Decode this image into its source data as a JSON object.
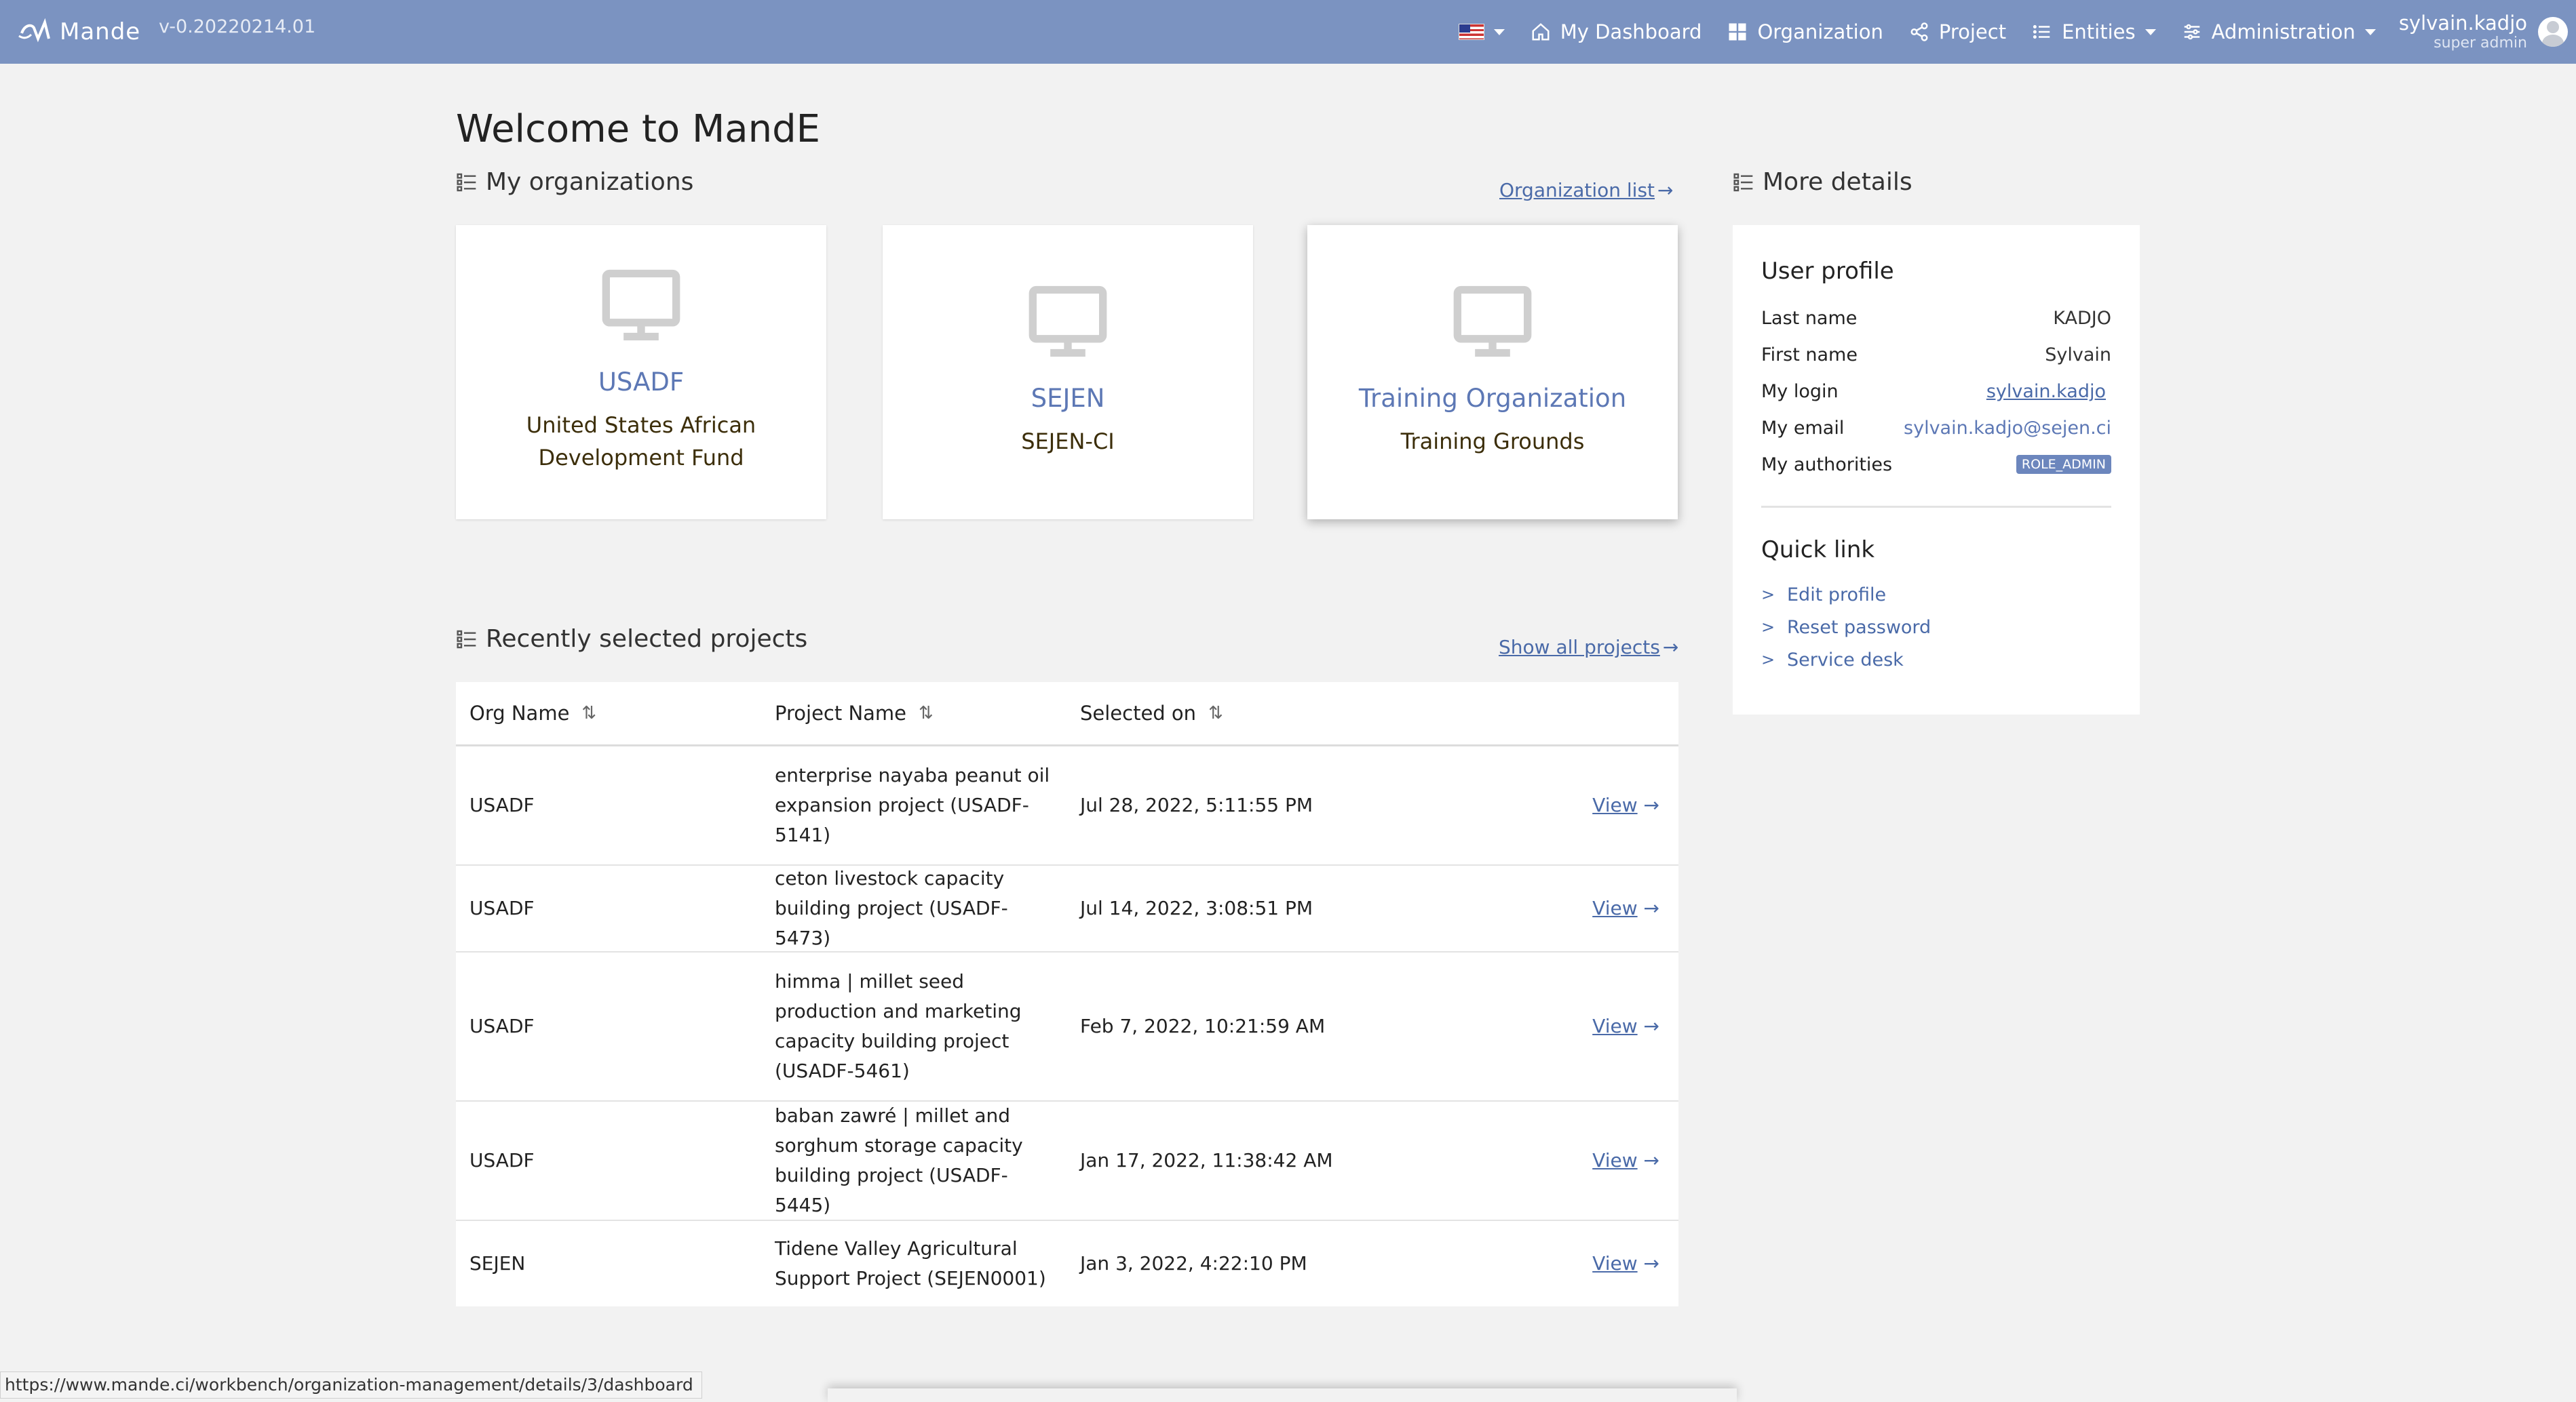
{
  "navbar": {
    "logo_text": "Mande",
    "version": "v-0.20220214.01",
    "items": [
      {
        "label": "My Dashboard",
        "icon": "home-icon"
      },
      {
        "label": "Organization",
        "icon": "grid-icon"
      },
      {
        "label": "Project",
        "icon": "share-icon"
      },
      {
        "label": "Entities",
        "icon": "list-icon"
      },
      {
        "label": "Administration",
        "icon": "sliders-icon"
      }
    ],
    "user": {
      "name": "sylvain.kadjo",
      "role": "super admin"
    },
    "colors": {
      "navbar": "#7b93c1",
      "accent": "#4a6aa8"
    }
  },
  "page": {
    "title": "Welcome to MandE"
  },
  "organizations": {
    "title": "My organizations",
    "list_link": "Organization list",
    "cards": [
      {
        "code": "USADF",
        "name": "United States African Development Fund"
      },
      {
        "code": "SEJEN",
        "name": "SEJEN-CI"
      },
      {
        "code": "Training Organization",
        "name": "Training Grounds"
      }
    ]
  },
  "projects": {
    "title": "Recently selected projects",
    "all_link": "Show all projects",
    "columns": [
      "Org Name",
      "Project Name",
      "Selected on"
    ],
    "view_label": "View",
    "rows": [
      {
        "org": "USADF",
        "name": "enterprise nayaba peanut oil expansion project (USADF-5141)",
        "selected_on": "Jul 28, 2022, 5:11:55 PM"
      },
      {
        "org": "USADF",
        "name": "ceton livestock capacity building project (USADF-5473)",
        "selected_on": "Jul 14, 2022, 3:08:51 PM"
      },
      {
        "org": "USADF",
        "name": "himma | millet seed production and marketing capacity building project (USADF-5461)",
        "selected_on": "Feb 7, 2022, 10:21:59 AM"
      },
      {
        "org": "USADF",
        "name": "baban zawré | millet and sorghum storage capacity building project (USADF-5445)",
        "selected_on": "Jan 17, 2022, 11:38:42 AM"
      },
      {
        "org": "SEJEN",
        "name": "Tidene Valley Agricultural Support Project (SEJEN0001)",
        "selected_on": "Jan 3, 2022, 4:22:10 PM"
      }
    ]
  },
  "details": {
    "title": "More details",
    "profile_heading": "User profile",
    "fields": {
      "last_name_label": "Last name",
      "last_name": "KADJO",
      "first_name_label": "First name",
      "first_name": "Sylvain",
      "login_label": "My login",
      "login": "sylvain.kadjo",
      "email_label": "My email",
      "email": "sylvain.kadjo@sejen.ci",
      "authorities_label": "My authorities",
      "authority": "ROLE_ADMIN"
    },
    "quick_link_heading": "Quick link",
    "quick_links": [
      "Edit profile",
      "Reset password",
      "Service desk"
    ]
  },
  "status_bar": {
    "url": "https://www.mande.ci/workbench/organization-management/details/3/dashboard"
  }
}
